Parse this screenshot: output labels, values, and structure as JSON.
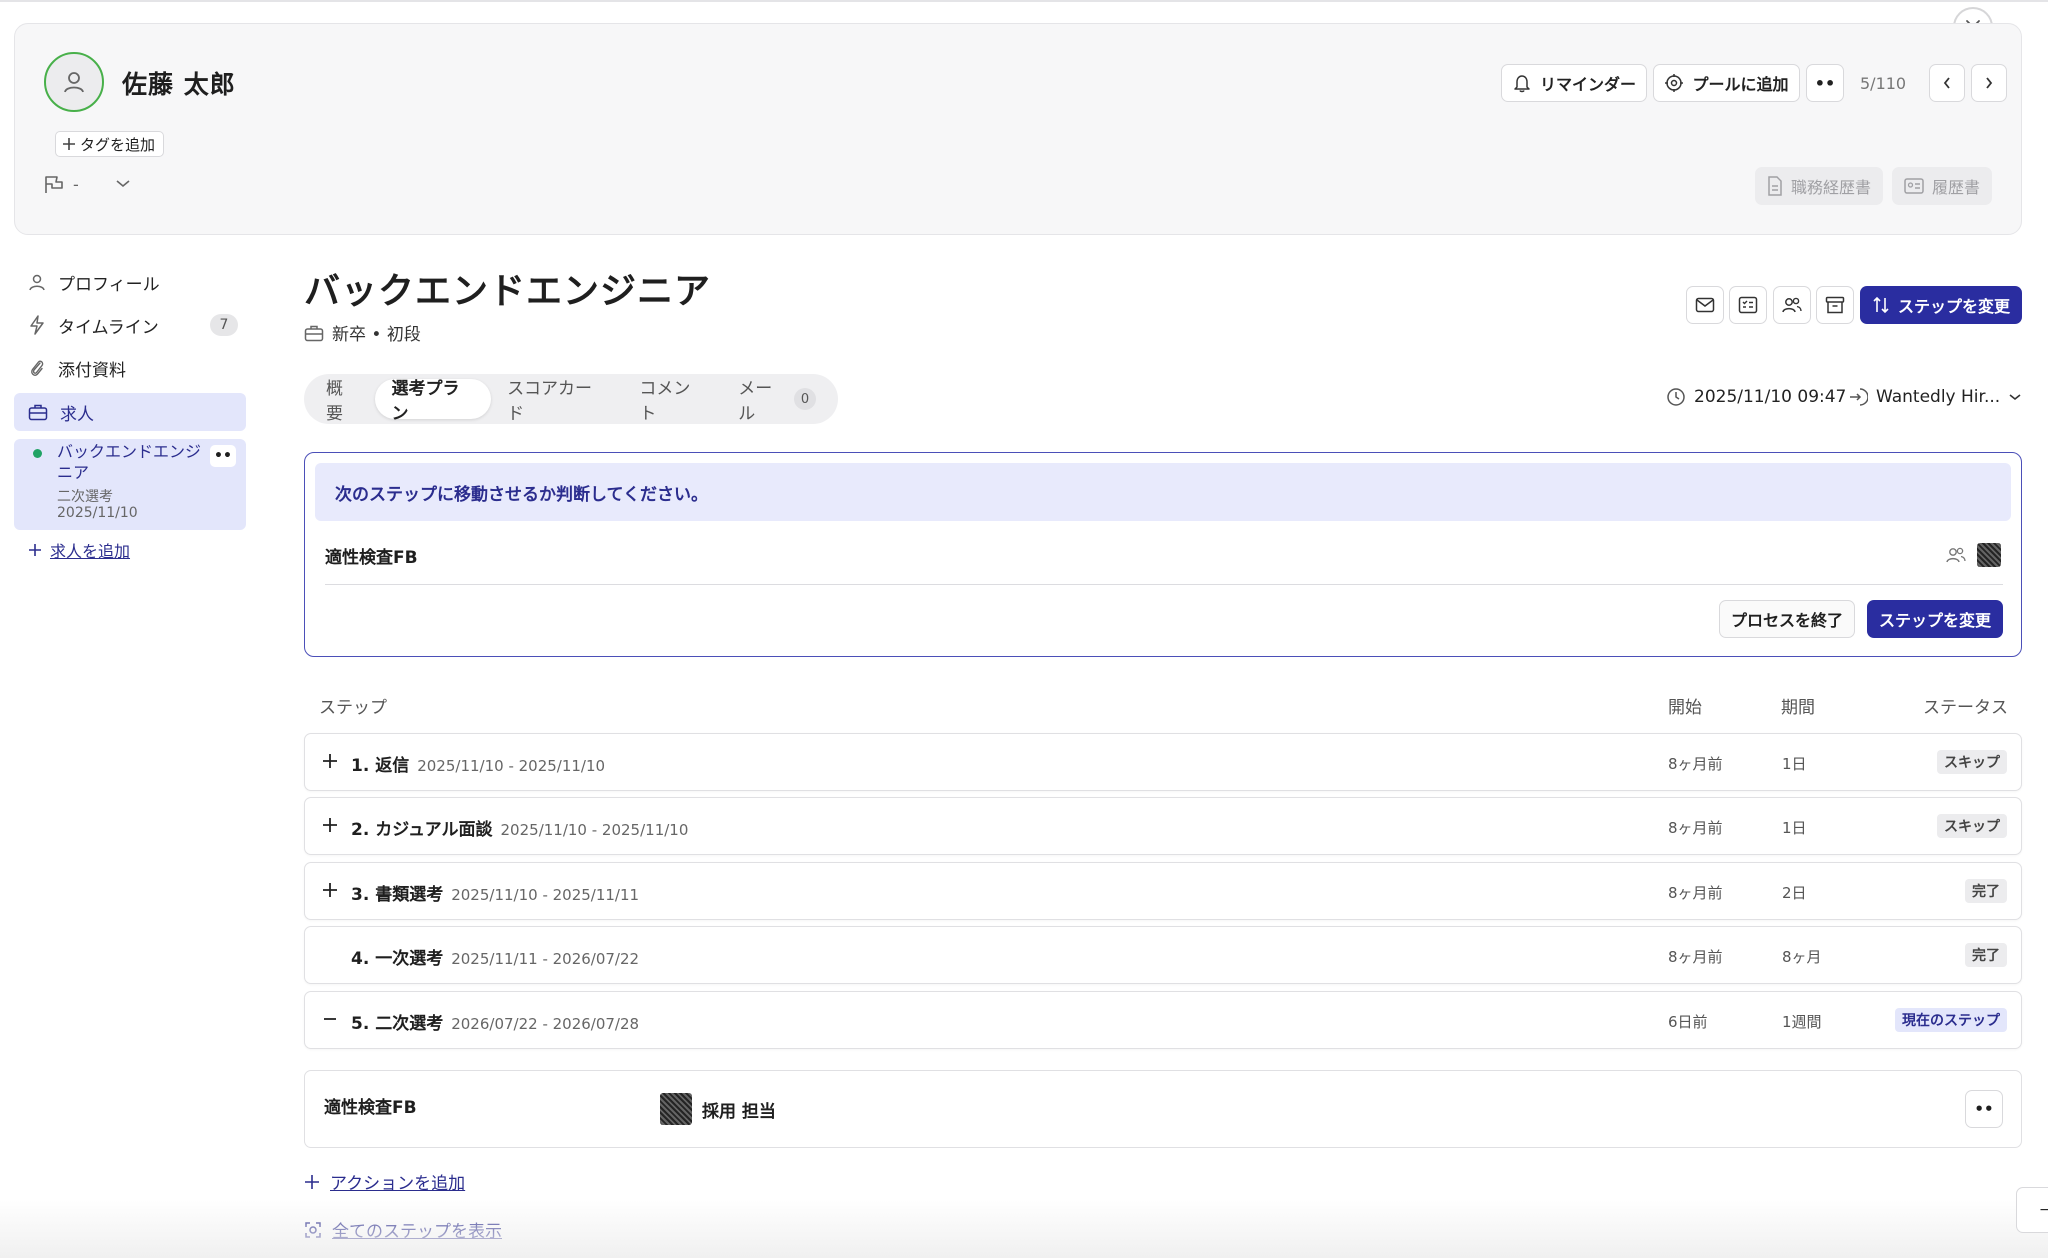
{
  "candidate": {
    "name": "佐藤 太郎",
    "add_tag_label": "タグを追加",
    "flag_value": "-"
  },
  "header_actions": {
    "reminder_label": "リマインダー",
    "pool_label": "プールに追加",
    "more_label": "••",
    "counter": "5/110",
    "resume_work_label": "職務経歴書",
    "resume_label": "履歴書"
  },
  "sidebar": {
    "items": [
      {
        "label": "プロフィール",
        "icon": "person-icon"
      },
      {
        "label": "タイムライン",
        "icon": "bolt-icon",
        "badge": "7"
      },
      {
        "label": "添付資料",
        "icon": "paperclip-icon"
      },
      {
        "label": "求人",
        "icon": "briefcase-icon"
      }
    ],
    "job": {
      "title": "バックエンドエンジニア",
      "stage": "二次選考",
      "date": "2025/11/10",
      "status_color": "#21a365"
    },
    "add_job_label": "求人を追加"
  },
  "main": {
    "title": "バックエンドエンジニア",
    "subtitle": "新卒 • 初段",
    "change_step_label": "ステップを変更",
    "tabs": [
      {
        "label": "概要"
      },
      {
        "label": "選考プラン"
      },
      {
        "label": "スコアカード"
      },
      {
        "label": "コメント"
      },
      {
        "label": "メール",
        "count": "0"
      }
    ],
    "active_tab": "選考プラン",
    "datetime": "2025/11/10 09:47",
    "source": "Wantedly Hir..."
  },
  "decision": {
    "banner": "次のステップに移動させるか判断してください。",
    "step_name": "適性検査FB",
    "end_label": "プロセスを終了",
    "change_label": "ステップを変更"
  },
  "steps_table": {
    "headers": {
      "step": "ステップ",
      "start": "開始",
      "duration": "期間",
      "status": "ステータス"
    },
    "rows": [
      {
        "expander": "+",
        "name": "1. 返信",
        "range": "2025/11/10 - 2025/11/10",
        "start": "8ヶ月前",
        "duration": "1日",
        "status": "スキップ"
      },
      {
        "expander": "+",
        "name": "2. カジュアル面談",
        "range": "2025/11/10 - 2025/11/10",
        "start": "8ヶ月前",
        "duration": "1日",
        "status": "スキップ"
      },
      {
        "expander": "+",
        "name": "3. 書類選考",
        "range": "2025/11/10 - 2025/11/11",
        "start": "8ヶ月前",
        "duration": "2日",
        "status": "完了"
      },
      {
        "expander": "",
        "name": "4. 一次選考",
        "range": "2025/11/11 - 2026/07/22",
        "start": "8ヶ月前",
        "duration": "8ヶ月",
        "status": "完了"
      },
      {
        "expander": "−",
        "name": "5. 二次選考",
        "range": "2026/07/22 - 2026/07/28",
        "start": "6日前",
        "duration": "1週間",
        "status": "現在のステップ"
      }
    ]
  },
  "action": {
    "name": "適性検査FB",
    "owner": "採用 担当",
    "more_label": "••"
  },
  "links": {
    "add_action": "アクションを追加",
    "show_all_steps": "全てのステップを表示"
  },
  "colors": {
    "primary": "#2a2da0",
    "accent_bg": "#e3e6fb",
    "success": "#21a365"
  }
}
